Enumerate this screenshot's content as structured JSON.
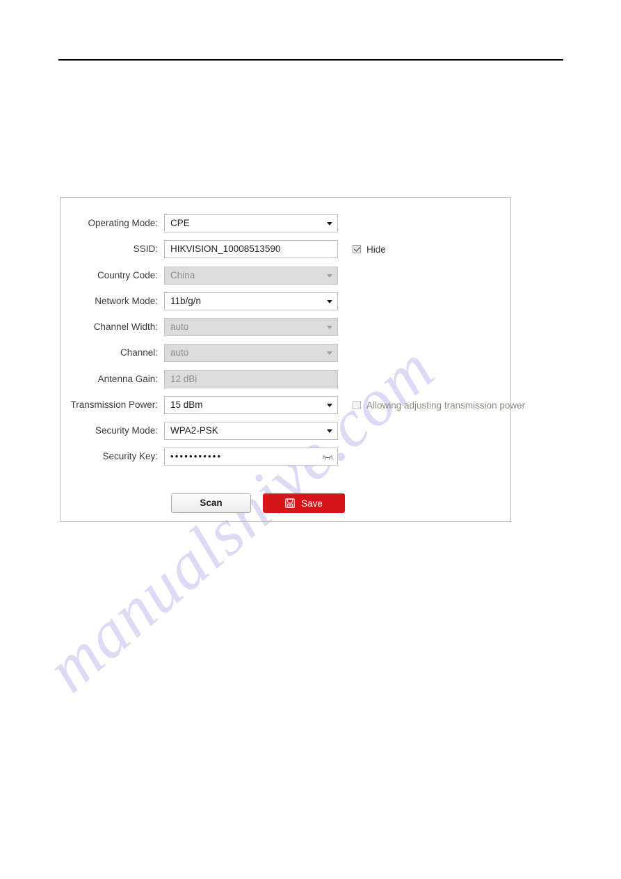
{
  "page": {
    "rule_visible": true,
    "watermark_text": "manualshive.com",
    "watermark_color": "#c8c4ee"
  },
  "form": {
    "rows": [
      {
        "id": "operating-mode",
        "label": "Operating Mode:",
        "type": "select",
        "value": "CPE",
        "disabled": false
      },
      {
        "id": "ssid",
        "label": "SSID:",
        "type": "text",
        "value": "HIKVISION_10008513590",
        "disabled": false
      },
      {
        "id": "country-code",
        "label": "Country Code:",
        "type": "select",
        "value": "China",
        "disabled": true
      },
      {
        "id": "network-mode",
        "label": "Network Mode:",
        "type": "select",
        "value": "11b/g/n",
        "disabled": false
      },
      {
        "id": "channel-width",
        "label": "Channel Width:",
        "type": "select",
        "value": "auto",
        "disabled": true
      },
      {
        "id": "channel",
        "label": "Channel:",
        "type": "select",
        "value": "auto",
        "disabled": true
      },
      {
        "id": "antenna-gain",
        "label": "Antenna Gain:",
        "type": "text",
        "value": "12 dBi",
        "disabled": true
      },
      {
        "id": "transmission-power",
        "label": "Transmission Power:",
        "type": "select",
        "value": "15 dBm",
        "disabled": false
      },
      {
        "id": "security-mode",
        "label": "Security Mode:",
        "type": "select",
        "value": "WPA2-PSK",
        "disabled": false
      },
      {
        "id": "security-key",
        "label": "Security Key:",
        "type": "password",
        "value": "•••••••••••",
        "disabled": false
      }
    ],
    "checkboxes": [
      {
        "id": "hide-ssid",
        "label": "Hide",
        "checked": true,
        "disabled": false
      },
      {
        "id": "allow-adjust-power",
        "label": "Allowing adjusting transmission power",
        "checked": false,
        "disabled": true
      }
    ],
    "buttons": {
      "scan_label": "Scan",
      "save_label": "Save",
      "save_icon": "floppy-disk-icon",
      "save_color": "#d7161b"
    }
  }
}
